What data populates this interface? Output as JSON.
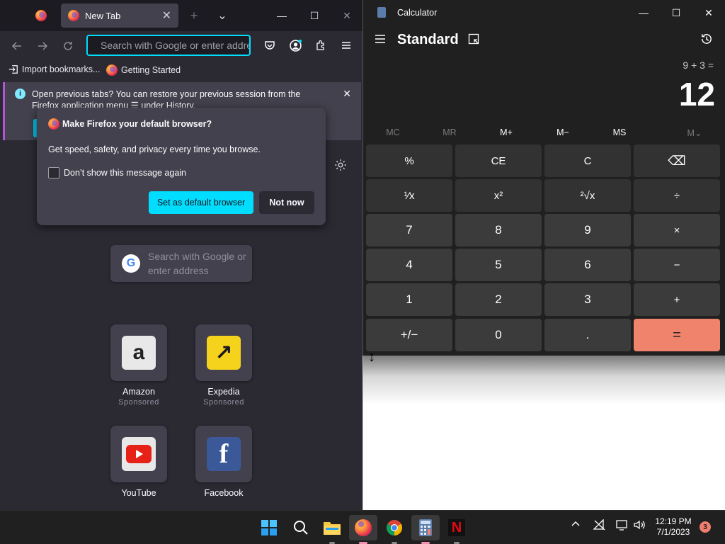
{
  "firefox": {
    "tab_title": "New Tab",
    "new_tab_symbol": "+",
    "list_tabs_symbol": "⌄",
    "minimize_symbol": "—",
    "maximize_symbol": "☐",
    "close_symbol": "✕",
    "url_placeholder": "Search with Google or enter address",
    "bookmarks": [
      {
        "label": "Import bookmarks...",
        "icon": "import-icon"
      },
      {
        "label": "Getting Started",
        "icon": "firefox-icon"
      }
    ],
    "notice": {
      "text": "Open previous tabs? You can restore your previous session from the Firefox application menu ☰ under History."
    },
    "popup": {
      "title": "Make Firefox your default browser?",
      "description": "Get speed, safety, and privacy every time you browse.",
      "checkbox_label": "Don’t show this message again",
      "primary_label": "Set as default browser",
      "secondary_label": "Not now"
    },
    "search_text": "Search with Google or enter address",
    "shortcuts": [
      {
        "name": "Amazon",
        "sponsored": "Sponsored"
      },
      {
        "name": "Expedia",
        "sponsored": "Sponsored"
      },
      {
        "name": "YouTube"
      },
      {
        "name": "Facebook"
      }
    ]
  },
  "calculator": {
    "title": "Calculator",
    "mode": "Standard",
    "expression": "9 + 3 =",
    "result": "12",
    "memory": [
      "MC",
      "MR",
      "M+",
      "M−",
      "MS",
      "M⌄"
    ],
    "keys": [
      [
        "%",
        "CE",
        "C",
        "⌫"
      ],
      [
        "¹⁄x",
        "x²",
        "²√x",
        "÷"
      ],
      [
        "7",
        "8",
        "9",
        "×"
      ],
      [
        "4",
        "5",
        "6",
        "−"
      ],
      [
        "1",
        "2",
        "3",
        "+"
      ],
      [
        "+/−",
        "0",
        ".",
        "="
      ]
    ]
  },
  "taskbar": {
    "time": "12:19 PM",
    "date": "7/1/2023",
    "notification_count": "3",
    "apps": [
      "start-icon",
      "search-icon",
      "file-explorer-icon",
      "firefox-icon",
      "chrome-icon",
      "calculator-icon",
      "netflix-icon"
    ]
  },
  "colors": {
    "firefox_accent": "#00ddff",
    "calc_equals": "#f0836b",
    "calc_bg": "#202020",
    "firefox_bg": "#2b2a33"
  }
}
